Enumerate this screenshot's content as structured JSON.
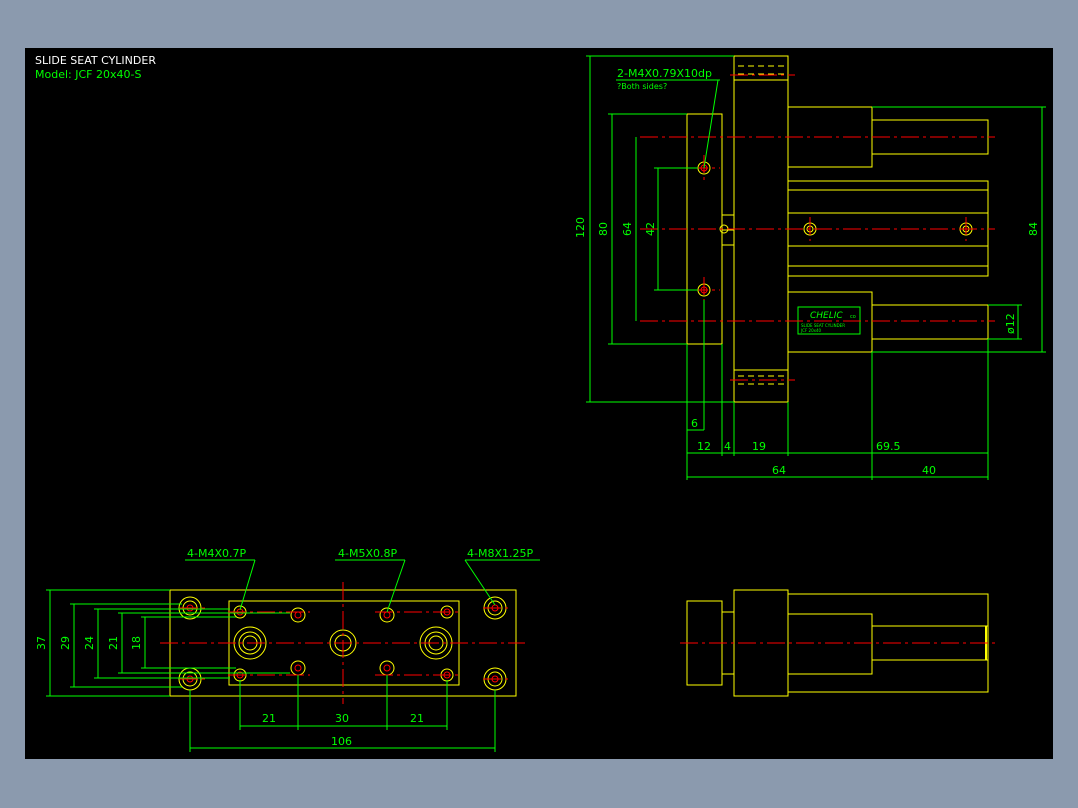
{
  "title_block": {
    "title": "SLIDE SEAT CYLINDER",
    "model": "Model: JCF 20x40-S"
  },
  "colors": {
    "outline": "#ffff00",
    "dimension": "#00ff00",
    "centerline": "#ff0000",
    "background": "#000000",
    "frame": "#8b9aae"
  },
  "top_view": {
    "callout": "2-M4X0.79X10dp",
    "callout_note": "?Both sides?",
    "logo": "CHELIC",
    "logo_suffix": "co",
    "nameplate_line1": "SLIDE SEAT CYLINDER",
    "nameplate_line2": "JCF 20x40",
    "dims": {
      "d120": "120",
      "d80": "80",
      "d64v": "64",
      "d42": "42",
      "d84": "84",
      "dia12": "ø12",
      "d6": "6",
      "d12": "12",
      "d4": "4",
      "d19": "19",
      "d69_5": "69.5",
      "d64h": "64",
      "d40": "40"
    }
  },
  "bottom_view": {
    "callouts": {
      "m4": "4-M4X0.7P",
      "m5": "4-M5X0.8P",
      "m8": "4-M8X1.25P"
    },
    "dims": {
      "d37": "37",
      "d29": "29",
      "d24": "24",
      "d21v": "21",
      "d18": "18",
      "d21a": "21",
      "d30": "30",
      "d21b": "21",
      "d106": "106"
    }
  }
}
